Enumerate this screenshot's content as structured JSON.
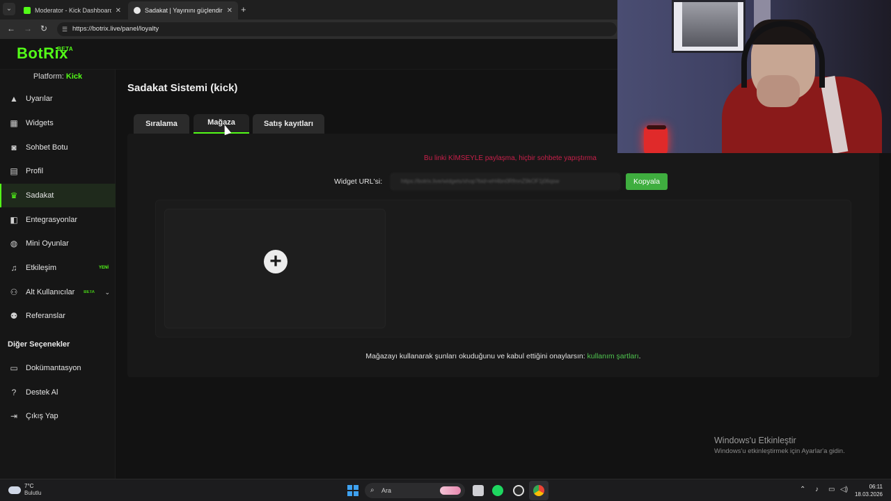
{
  "browser": {
    "tabs": [
      {
        "title": "Moderator - Kick Dashboard",
        "favicon_color": "#53fc18"
      },
      {
        "title": "Sadakat | Yayınını güçlendirmek",
        "favicon_color": "#e8e8e8"
      }
    ],
    "url": "https://botrix.live/panel/loyalty"
  },
  "app": {
    "logo": "BotRix",
    "logo_badge": "BETA",
    "platform_label": "Platform:",
    "platform_value": "Kick",
    "accent_color": "#53fc18"
  },
  "sidebar": {
    "items": [
      {
        "label": "Uyarılar",
        "icon": "warning-icon"
      },
      {
        "label": "Widgets",
        "icon": "widgets-icon"
      },
      {
        "label": "Sohbet Botu",
        "icon": "robot-icon"
      },
      {
        "label": "Profil",
        "icon": "profile-card-icon"
      },
      {
        "label": "Sadakat",
        "icon": "trophy-icon",
        "active": true
      },
      {
        "label": "Entegrasyonlar",
        "icon": "integration-icon"
      },
      {
        "label": "Mini Oyunlar",
        "icon": "gamepad-icon"
      },
      {
        "label": "Etkileşim",
        "icon": "music-note-icon",
        "badge": "YENİ"
      },
      {
        "label": "Alt Kullanıcılar",
        "icon": "users-icon",
        "badge": "BETA"
      },
      {
        "label": "Referanslar",
        "icon": "referral-icon"
      }
    ],
    "other_title": "Diğer Seçenekler",
    "other_items": [
      {
        "label": "Dokümantasyon",
        "icon": "docs-icon"
      },
      {
        "label": "Destek Al",
        "icon": "help-icon"
      },
      {
        "label": "Çıkış Yap",
        "icon": "logout-icon"
      }
    ]
  },
  "main": {
    "title": "Sadakat Sistemi (kick)",
    "tabs": [
      {
        "label": "Sıralama"
      },
      {
        "label": "Mağaza",
        "active": true
      },
      {
        "label": "Satış kayıtları"
      }
    ],
    "warning": "Bu linki KİMSEYLE paylaşma, hiçbir sohbete yapıştırma",
    "widget_url_label": "Widget URL'si:",
    "widget_url_value": "https://botrix.live/widgets/shop?bid=eH4bn0RfmnZ9kOF1j06qsw",
    "copy_button": "Kopyala",
    "terms_text": "Mağazayı kullanarak şunları okuduğunu ve kabul ettiğini onaylarsın:",
    "terms_link": "kullanım şartları",
    "terms_suffix": "."
  },
  "os": {
    "activation_title": "Windows'u Etkinleştir",
    "activation_sub": "Windows'u etkinleştirmek için Ayarlar'a gidin.",
    "weather_temp": "7°C",
    "weather_cond": "Bulutlu",
    "search_placeholder": "Ara",
    "time": "06:11",
    "date": "18.03.2026"
  }
}
